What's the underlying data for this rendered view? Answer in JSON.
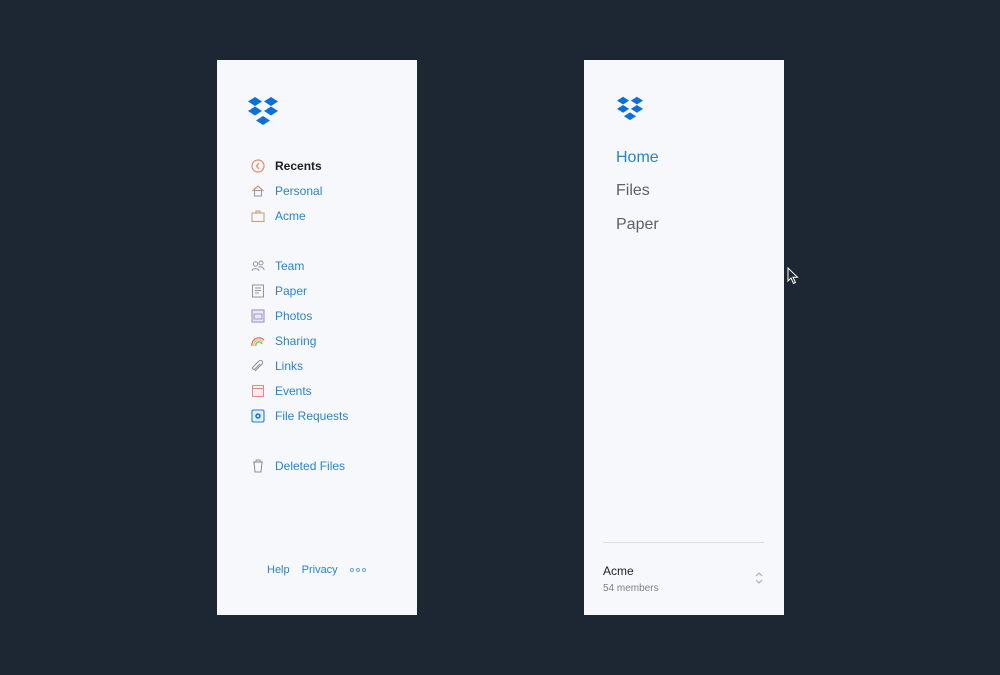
{
  "left_panel": {
    "nav_groups": [
      [
        {
          "label": "Recents",
          "icon": "recents-clock-icon",
          "active": true
        },
        {
          "label": "Personal",
          "icon": "home-icon"
        },
        {
          "label": "Acme",
          "icon": "briefcase-icon"
        }
      ],
      [
        {
          "label": "Team",
          "icon": "team-icon"
        },
        {
          "label": "Paper",
          "icon": "paper-doc-icon"
        },
        {
          "label": "Photos",
          "icon": "photos-icon"
        },
        {
          "label": "Sharing",
          "icon": "rainbow-sharing-icon"
        },
        {
          "label": "Links",
          "icon": "paperclip-link-icon"
        },
        {
          "label": "Events",
          "icon": "calendar-events-icon"
        },
        {
          "label": "File Requests",
          "icon": "file-request-icon"
        }
      ],
      [
        {
          "label": "Deleted Files",
          "icon": "trash-icon"
        }
      ]
    ],
    "footer": {
      "help_label": "Help",
      "privacy_label": "Privacy",
      "more_icon": "more-dots-icon"
    }
  },
  "right_panel": {
    "nav": [
      {
        "label": "Home",
        "active": true
      },
      {
        "label": "Files"
      },
      {
        "label": "Paper"
      }
    ],
    "team": {
      "name": "Acme",
      "members": "54 members"
    }
  },
  "colors": {
    "background": "#1d2733",
    "panel": "#f6f8fb",
    "accent": "#2a84cc",
    "brand_blue": "#0d6fd8"
  }
}
